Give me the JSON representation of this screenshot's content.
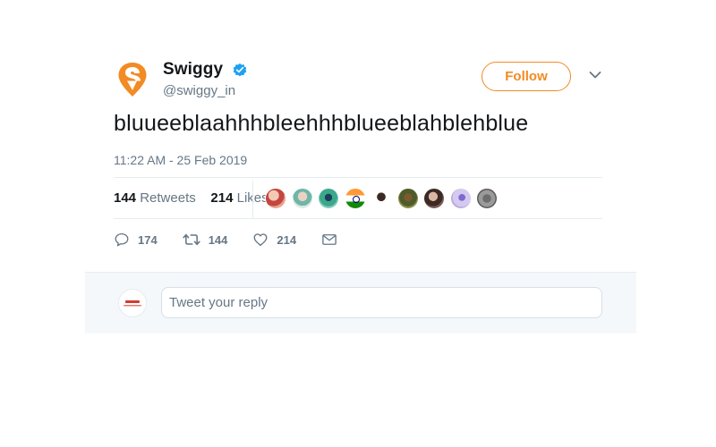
{
  "tweet": {
    "display_name": "Swiggy",
    "handle": "@swiggy_in",
    "follow_label": "Follow",
    "text": "bluueeblaahhhbleehhhblueeblahblehblue",
    "timestamp": "11:22 AM - 25 Feb 2019"
  },
  "stats": {
    "retweets_count": "144",
    "retweets_label": "Retweets",
    "likes_count": "214",
    "likes_label": "Likes"
  },
  "likers": [
    {
      "name": "liker-avatar-1"
    },
    {
      "name": "liker-avatar-2"
    },
    {
      "name": "liker-avatar-3"
    },
    {
      "name": "liker-avatar-4"
    },
    {
      "name": "liker-avatar-5"
    },
    {
      "name": "liker-avatar-6"
    },
    {
      "name": "liker-avatar-7"
    },
    {
      "name": "liker-avatar-8"
    },
    {
      "name": "liker-avatar-9"
    }
  ],
  "actions": {
    "replies": "174",
    "retweets": "144",
    "likes": "214"
  },
  "reply": {
    "placeholder": "Tweet your reply"
  },
  "colors": {
    "brand_orange": "#f38a23",
    "verified_blue": "#1da1f2",
    "secondary_text": "#657786"
  },
  "icons": {
    "brand_logo": "swiggy-logo-icon",
    "verified": "verified-badge-icon",
    "caret": "chevron-down-icon",
    "reply": "reply-icon",
    "retweet": "retweet-icon",
    "like": "heart-icon",
    "dm": "envelope-icon"
  }
}
